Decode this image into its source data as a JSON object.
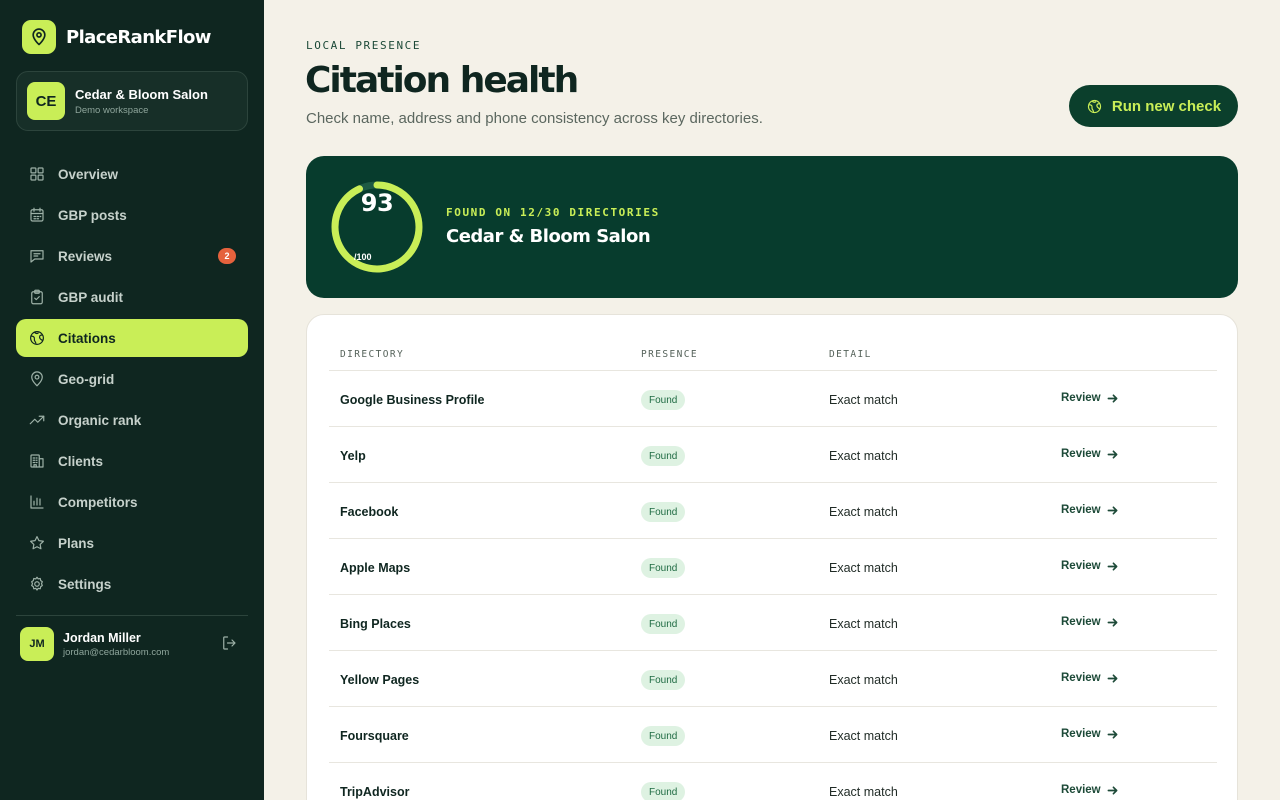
{
  "brand": {
    "name": "PlaceRankFlow",
    "icon": "map-pin-icon"
  },
  "workspace": {
    "initials": "CE",
    "name": "Cedar & Bloom Salon",
    "subtitle": "Demo workspace"
  },
  "nav": [
    {
      "label": "Overview",
      "icon": "grid-icon"
    },
    {
      "label": "GBP posts",
      "icon": "calendar-icon"
    },
    {
      "label": "Reviews",
      "icon": "message-icon",
      "badge": "2"
    },
    {
      "label": "GBP audit",
      "icon": "clipboard-check-icon"
    },
    {
      "label": "Citations",
      "icon": "globe-icon",
      "active": true
    },
    {
      "label": "Geo-grid",
      "icon": "map-pin-icon"
    },
    {
      "label": "Organic rank",
      "icon": "trending-up-icon"
    },
    {
      "label": "Clients",
      "icon": "building-icon"
    },
    {
      "label": "Competitors",
      "icon": "bar-chart-icon"
    },
    {
      "label": "Plans",
      "icon": "star-icon"
    },
    {
      "label": "Settings",
      "icon": "gear-icon"
    }
  ],
  "user": {
    "initials": "JM",
    "name": "Jordan Miller",
    "email": "jordan@cedarbloom.com",
    "logout_icon": "logout-icon"
  },
  "header": {
    "eyebrow": "LOCAL PRESENCE",
    "title": "Citation health",
    "subtitle": "Check name, address and phone consistency across key directories.",
    "run_button": "Run new check",
    "run_icon": "globe-icon"
  },
  "score": {
    "value": "93",
    "max": "/100",
    "percent": 93,
    "found_label": "FOUND ON 12/30 DIRECTORIES",
    "business_name": "Cedar & Bloom Salon"
  },
  "table": {
    "columns": [
      "DIRECTORY",
      "PRESENCE",
      "DETAIL"
    ],
    "rows": [
      {
        "directory": "Google Business Profile",
        "presence": "Found",
        "detail": "Exact match",
        "action": "Review"
      },
      {
        "directory": "Yelp",
        "presence": "Found",
        "detail": "Exact match",
        "action": "Review"
      },
      {
        "directory": "Facebook",
        "presence": "Found",
        "detail": "Exact match",
        "action": "Review"
      },
      {
        "directory": "Apple Maps",
        "presence": "Found",
        "detail": "Exact match",
        "action": "Review"
      },
      {
        "directory": "Bing Places",
        "presence": "Found",
        "detail": "Exact match",
        "action": "Review"
      },
      {
        "directory": "Yellow Pages",
        "presence": "Found",
        "detail": "Exact match",
        "action": "Review"
      },
      {
        "directory": "Foursquare",
        "presence": "Found",
        "detail": "Exact match",
        "action": "Review"
      },
      {
        "directory": "TripAdvisor",
        "presence": "Found",
        "detail": "Exact match",
        "action": "Review"
      }
    ]
  },
  "colors": {
    "sidebar": "#0f2620",
    "accent": "#c9ee57",
    "card": "#073c2d",
    "background": "#f4f1e8",
    "badge": "#e5623d",
    "pill": "#def2e2"
  }
}
